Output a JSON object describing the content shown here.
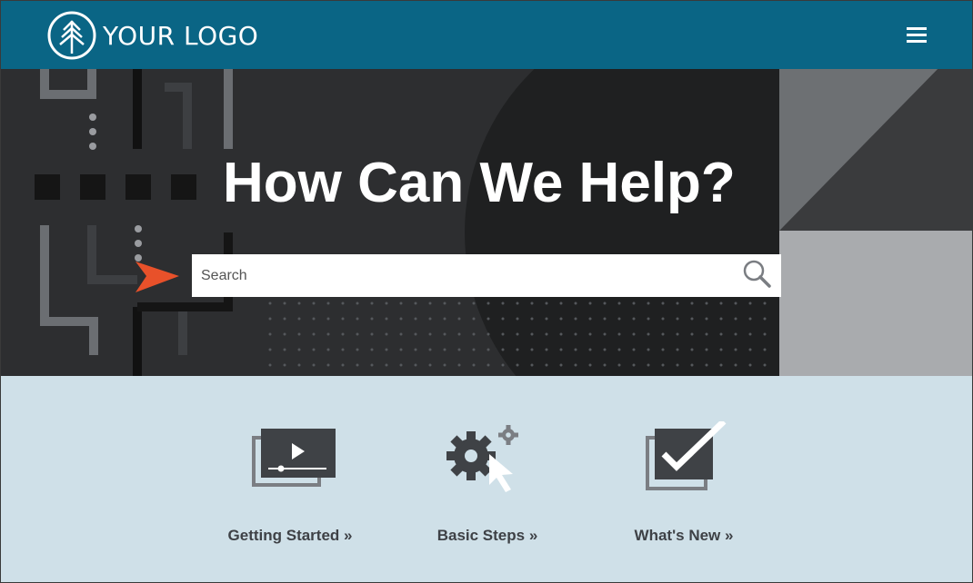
{
  "header": {
    "logo_text": "YOUR LOGO",
    "logo_icon": "tree-icon",
    "menu_icon": "hamburger-menu-icon",
    "background_color": "#0a6585"
  },
  "hero": {
    "title": "How Can We Help?",
    "search": {
      "placeholder": "Search",
      "value": "",
      "icon": "search-icon"
    },
    "pointer_icon": "orange-arrow-pointer-icon",
    "accent_color": "#e8512a"
  },
  "tiles": [
    {
      "label": "Getting Started »",
      "icon": "video-player-icon"
    },
    {
      "label": "Basic Steps »",
      "icon": "gears-cursor-icon"
    },
    {
      "label": "What's New »",
      "icon": "checkbox-check-icon"
    }
  ],
  "colors": {
    "tiles_background": "#cfe0e8",
    "hero_background": "#2b2c2e",
    "label_text": "#3e4146"
  }
}
